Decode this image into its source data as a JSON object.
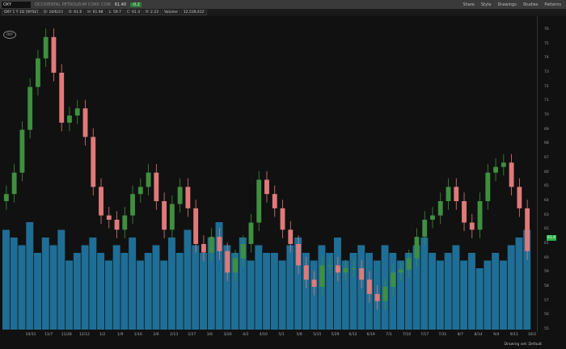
{
  "toolbar": {
    "symbol": "OXY",
    "company": "OCCIDENTAL PETROLEUM CORP. COM",
    "last": "61.40",
    "change": "-0.2",
    "share": "Share",
    "style": "Style",
    "drawings": "Drawings",
    "studies": "Studies",
    "patterns": "Patterns"
  },
  "info": {
    "title": "OXY 1 Y 1D [NYSE]",
    "date": "D: 10/6/23",
    "open": "O: 61.6",
    "high": "H: 61.98",
    "low": "L: 59.7",
    "close": "C: 61.4",
    "range": "R: 2.23",
    "volume_label": "Volume",
    "volume": "12,539,412"
  },
  "logo": "OXY",
  "status": {
    "drawing_set": "Drawing set: Default"
  },
  "colors": {
    "up": "#3f8f3f",
    "down": "#e07a7a",
    "volume": "#1f6e96",
    "badge": "#2db34a"
  },
  "chart_data": {
    "type": "candlestick",
    "ylim": [
      55,
      76
    ],
    "yticks": [
      76,
      75,
      74,
      73,
      72,
      71,
      70,
      69,
      68,
      67,
      66,
      65,
      64,
      63,
      62,
      61,
      60,
      59,
      58,
      57,
      56,
      55
    ],
    "last_price": "61.4",
    "xticks": [
      "10/31",
      "11/7",
      "11/28",
      "12/12",
      "1/2",
      "1/9",
      "1/16",
      "2/6",
      "2/13",
      "2/27",
      "3/6",
      "3/20",
      "4/3",
      "4/10",
      "5/1",
      "5/8",
      "5/15",
      "5/29",
      "6/12",
      "6/19",
      "7/3",
      "7/10",
      "7/17",
      "7/31",
      "8/7",
      "8/14",
      "9/4",
      "9/11",
      "10/2"
    ],
    "closes": [
      64.5,
      66,
      69,
      72,
      74,
      75.5,
      73,
      69.5,
      70,
      70.5,
      68.5,
      65,
      63,
      62.7,
      62,
      63,
      64.5,
      65,
      66,
      64,
      62,
      63.8,
      65,
      63.5,
      61,
      60.4,
      61.5,
      60.5,
      59,
      60,
      61,
      62.5,
      65.5,
      64.5,
      63.5,
      62,
      61,
      59.5,
      58.5,
      58,
      59.5,
      59.5,
      59,
      59.3,
      59.3,
      58.5,
      57.5,
      57,
      58,
      59,
      59.2,
      60,
      61.5,
      62.7,
      63,
      64,
      65,
      64,
      62.5,
      62,
      64,
      66,
      66.4,
      66.7,
      65,
      63.5,
      60.5
    ],
    "volumes_m": [
      13,
      12,
      11,
      14,
      10,
      12,
      11,
      13,
      9,
      10,
      11,
      12,
      10,
      9,
      11,
      10,
      12,
      9,
      10,
      11,
      9,
      12,
      10,
      13,
      11,
      10,
      12,
      14,
      11,
      10,
      12,
      9,
      11,
      10,
      10,
      9,
      11,
      12,
      10,
      9,
      11,
      10,
      12,
      9,
      10,
      11,
      10,
      9,
      11,
      10,
      9,
      10,
      11,
      12,
      10,
      9,
      10,
      11,
      9,
      10,
      8,
      9,
      10,
      9,
      11,
      12,
      13
    ]
  }
}
